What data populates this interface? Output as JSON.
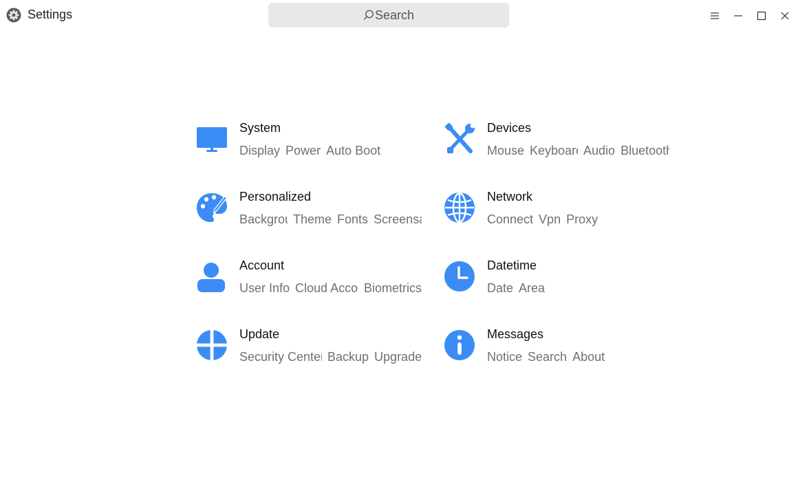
{
  "window": {
    "title": "Settings"
  },
  "search": {
    "placeholder": "Search"
  },
  "accent": "#3b8cf5",
  "categories": [
    {
      "title": "System",
      "icon": "monitor-icon",
      "items": [
        "Display",
        "Power",
        "Auto Boot"
      ]
    },
    {
      "title": "Devices",
      "icon": "tools-icon",
      "items": [
        "Mouse",
        "Keyboard",
        "Audio",
        "Bluetooth"
      ]
    },
    {
      "title": "Personalized",
      "icon": "palette-icon",
      "items": [
        "Background",
        "Theme",
        "Fonts",
        "Screensaver"
      ]
    },
    {
      "title": "Network",
      "icon": "globe-icon",
      "items": [
        "Connect",
        "Vpn",
        "Proxy"
      ]
    },
    {
      "title": "Account",
      "icon": "user-icon",
      "items": [
        "User Info",
        "Cloud Account",
        "Biometrics"
      ]
    },
    {
      "title": "Datetime",
      "icon": "clock-icon",
      "items": [
        "Date",
        "Area"
      ]
    },
    {
      "title": "Update",
      "icon": "update-icon",
      "items": [
        "Security Center",
        "Backup",
        "Upgrade"
      ]
    },
    {
      "title": "Messages",
      "icon": "info-icon",
      "items": [
        "Notice",
        "Search",
        "About"
      ]
    }
  ]
}
